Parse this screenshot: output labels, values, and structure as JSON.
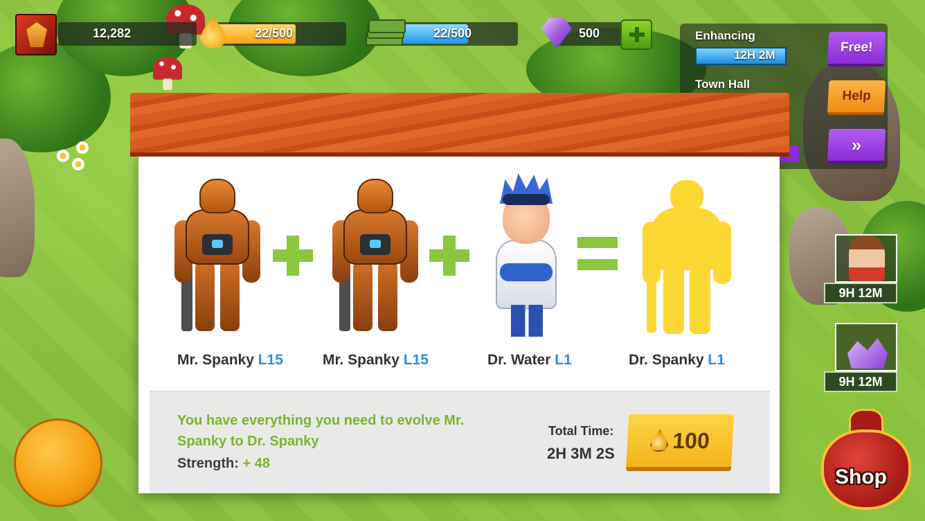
{
  "hud": {
    "score": "12,282",
    "elixir": "22/500",
    "elixir_fill": 0.62,
    "cash": "22/500",
    "cash_fill": 0.62,
    "gems": "500"
  },
  "side": {
    "enhancing_label": "Enhancing",
    "enhancing_timer": "12H 2M",
    "building_label": "Town Hall",
    "free_label": "Free!",
    "help_label": "Help",
    "skip_label": "»",
    "timer_boxer": "9H 12M",
    "timer_gems": "9H 12M",
    "shop_label": "Shop"
  },
  "evolve": {
    "ingredients": [
      {
        "name": "Mr. Spanky",
        "level": "L15"
      },
      {
        "name": "Mr. Spanky",
        "level": "L15"
      },
      {
        "name": "Dr. Water",
        "level": "L1"
      }
    ],
    "result": {
      "name": "Dr. Spanky",
      "level": "L1"
    },
    "description": "You have everything you need to evolve Mr. Spanky to Dr. Spanky",
    "strength_label": "Strength:",
    "strength_value": "+ 48",
    "total_time_label": "Total Time:",
    "total_time_value": "2H 3M 2S",
    "cost": "100"
  },
  "colors": {
    "level_blue": "#2a8fe0",
    "accent_green": "#8cc63f",
    "header_orange": "#d85c22",
    "button_yellow": "#ffd447",
    "silhouette_yellow": "#fcd835"
  }
}
